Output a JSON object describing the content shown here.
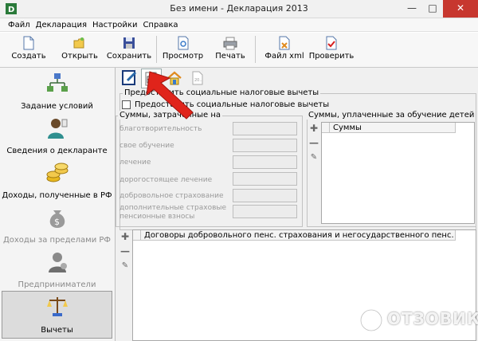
{
  "window": {
    "title": "Без имени - Декларация 2013"
  },
  "menu": [
    "Файл",
    "Декларация",
    "Настройки",
    "Справка"
  ],
  "toolbar": {
    "create": "Создать",
    "open": "Открыть",
    "save": "Сохранить",
    "preview": "Просмотр",
    "print": "Печать",
    "xml": "Файл xml",
    "check": "Проверить"
  },
  "sidebar": {
    "items": [
      {
        "label": "Задание условий",
        "icon": "hierarchy-icon"
      },
      {
        "label": "Сведения о декларанте",
        "icon": "person-icon"
      },
      {
        "label": "Доходы, полученные в РФ",
        "icon": "coins-icon"
      },
      {
        "label": "Доходы за пределами РФ",
        "icon": "money-bag-icon"
      },
      {
        "label": "Предприниматели",
        "icon": "businessman-icon"
      },
      {
        "label": "Вычеты",
        "icon": "scales-icon"
      }
    ]
  },
  "content": {
    "social_group_title": "Предоставить социальные налоговые вычеты",
    "social_checkbox_label": "Предоставить социальные налоговые вычеты",
    "expenses_group_title": "Суммы, затраченные на",
    "fields": [
      "благотворительность",
      "свое обучение",
      "лечение",
      "дорогостоящее лечение",
      "добровольное страхование",
      "дополнительные страховые пенсионные взносы"
    ],
    "children_group_title": "Суммы, уплаченные за обучение детей",
    "children_grid_header": "Суммы",
    "contracts_grid_header": "Договоры добровольного пенс. страхования и негосударственного пенс. обес..."
  },
  "watermark": {
    "text": "ОТЗОВИК"
  },
  "colors": {
    "close_button": "#c7372f",
    "arrow": "#e0241b",
    "checked": "#d61f1f"
  }
}
